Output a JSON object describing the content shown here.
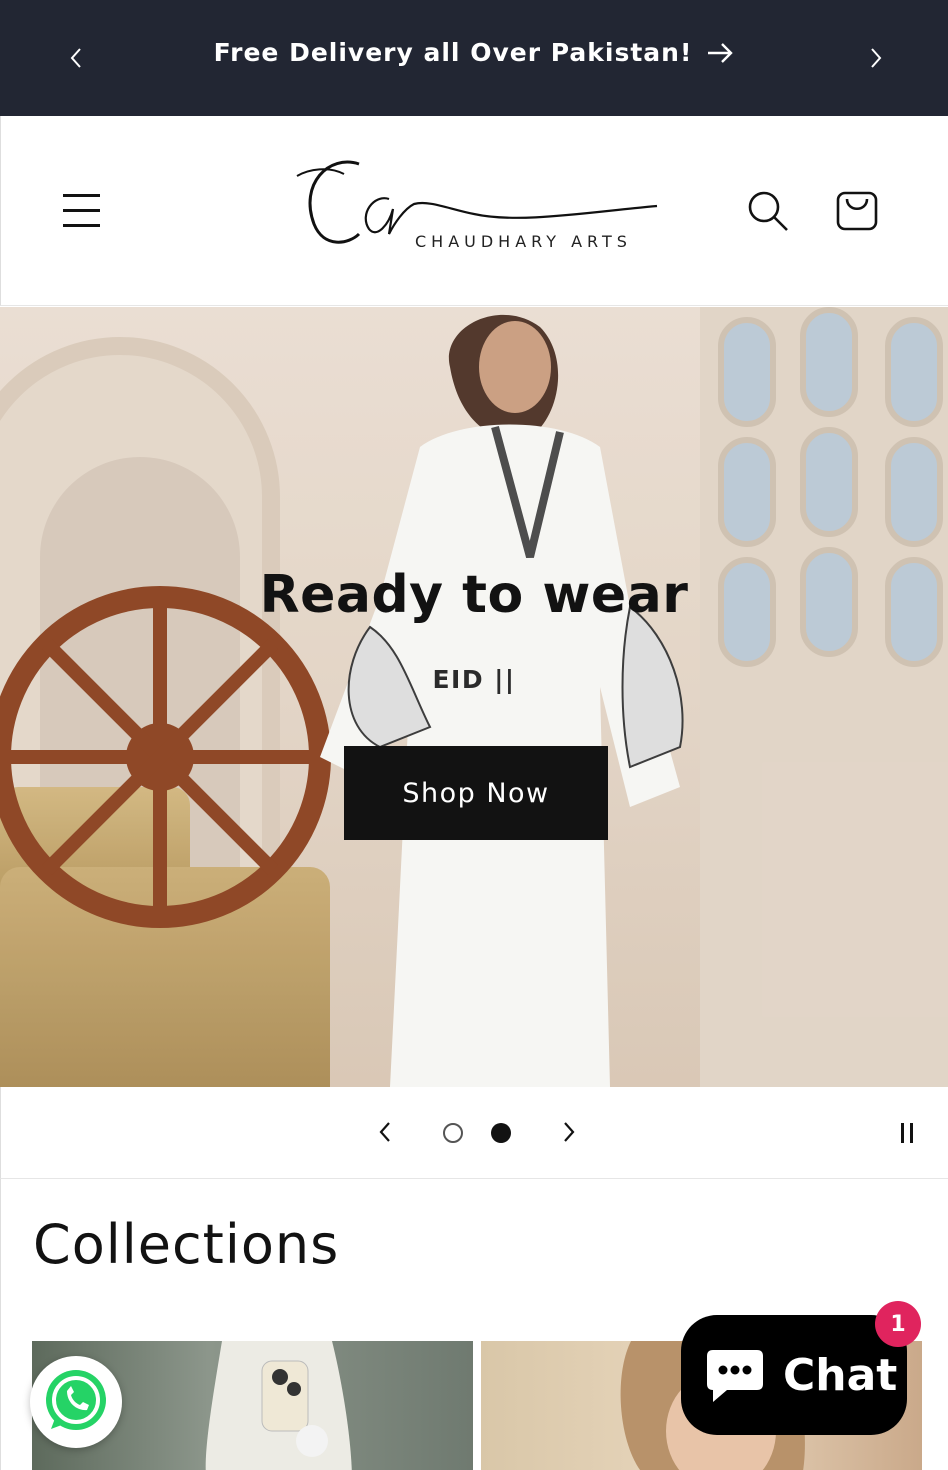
{
  "announcement": {
    "message": "Free Delivery all Over Pakistan!"
  },
  "header": {
    "logo_script": "Ca",
    "logo_name": "CHAUDHARY ARTS"
  },
  "hero": {
    "title": "Ready to wear",
    "subtitle": "EID ||",
    "cta_label": "Shop Now"
  },
  "slider": {
    "total_slides": 2,
    "current_slide": 2
  },
  "collections": {
    "heading": "Collections"
  },
  "chat": {
    "label": "Chat",
    "badge_count": "1"
  },
  "colors": {
    "announcement_bg": "#222633",
    "button_bg": "#121212",
    "badge": "#e0245e",
    "whatsapp": "#25d366"
  }
}
